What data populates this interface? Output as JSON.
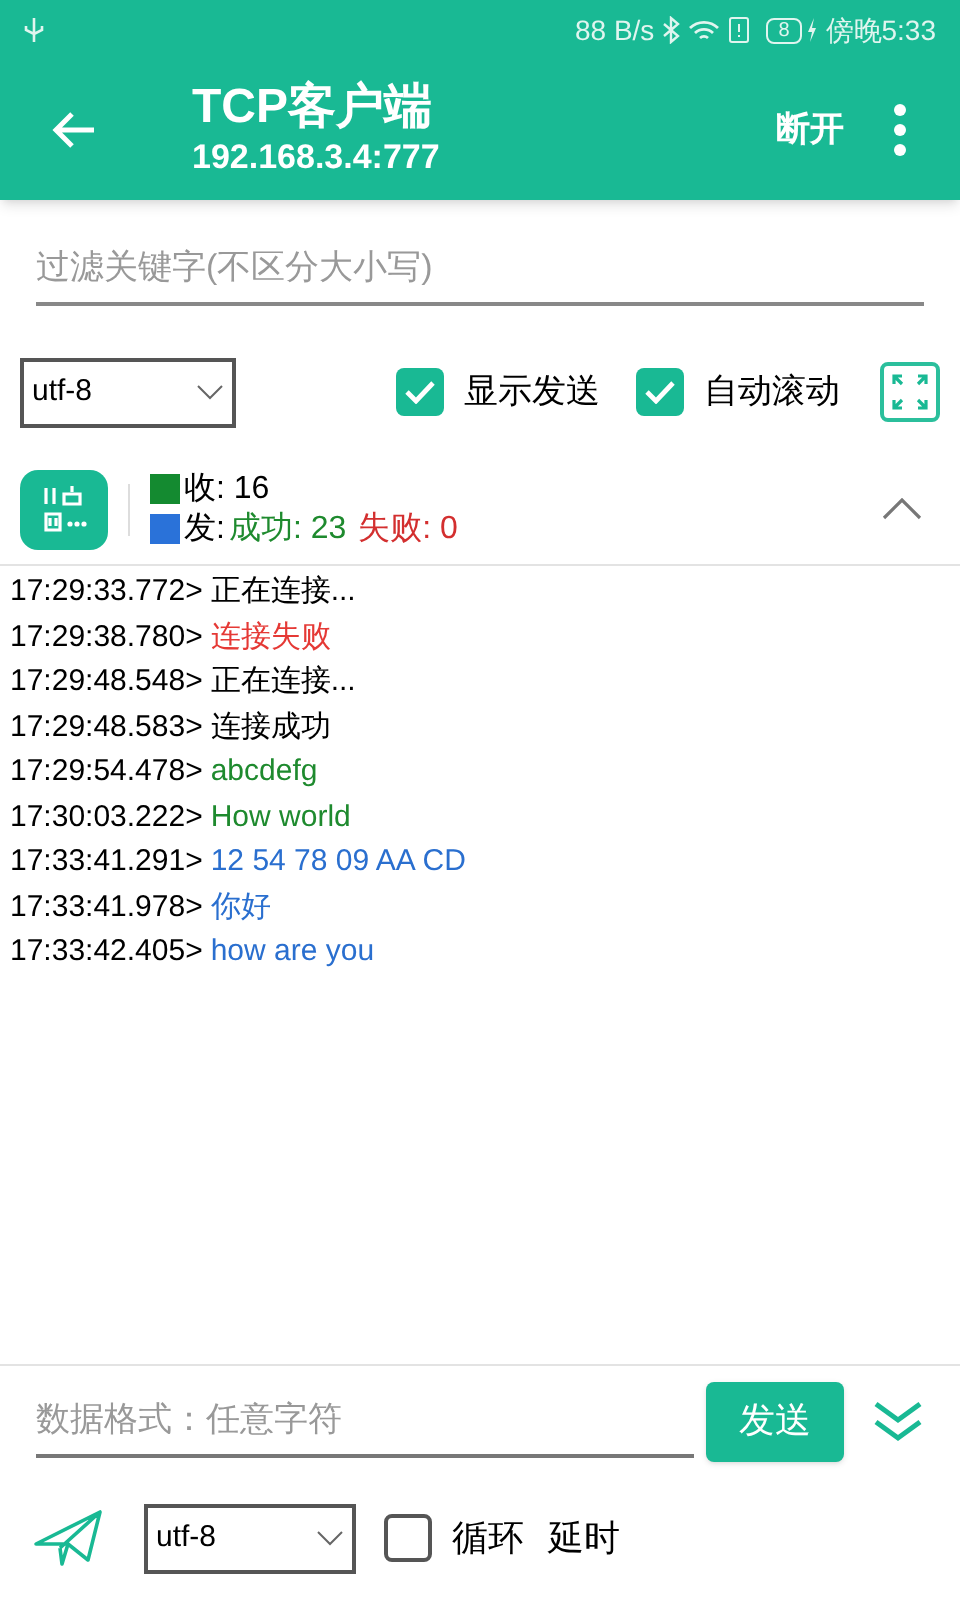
{
  "status_bar": {
    "speed": "88 B/s",
    "battery": "8",
    "time": "傍晚5:33"
  },
  "toolbar": {
    "title": "TCP客户端",
    "subtitle": "192.168.3.4:777",
    "action": "断开"
  },
  "filter": {
    "placeholder": "过滤关键字(不区分大小写)"
  },
  "options": {
    "encoding": "utf-8",
    "checkboxes": [
      {
        "label": "显示发送",
        "checked": true
      },
      {
        "label": "自动滚动",
        "checked": true
      }
    ]
  },
  "stats": {
    "received_label": "收:",
    "received": "16",
    "sent_label": "发:",
    "success": "成功: 23",
    "failure": "失败: 0",
    "expanded": true
  },
  "log": [
    {
      "time": "17:29:33.772>",
      "text": "正在连接...",
      "color": "#000000"
    },
    {
      "time": "17:29:38.780>",
      "text": "连接失败",
      "color": "#e53935"
    },
    {
      "time": "17:29:48.548>",
      "text": "正在连接...",
      "color": "#000000"
    },
    {
      "time": "17:29:48.583>",
      "text": "连接成功",
      "color": "#000000"
    },
    {
      "time": "17:29:54.478>",
      "text": "abcdefg",
      "color": "#1e8a2e"
    },
    {
      "time": "17:30:03.222>",
      "text": "How world",
      "color": "#1e8a2e"
    },
    {
      "time": "17:33:41.291>",
      "text": "12 54 78 09 AA CD",
      "color": "#2a6fcf"
    },
    {
      "time": "17:33:41.978>",
      "text": "你好",
      "color": "#2a6fcf"
    },
    {
      "time": "17:33:42.405>",
      "text": "how are you",
      "color": "#2a6fcf"
    }
  ],
  "send": {
    "placeholder": "数据格式：任意字符",
    "button": "发送",
    "encoding": "utf-8",
    "loop": {
      "label": "循环",
      "checked": false
    },
    "delay_label": "延时"
  }
}
